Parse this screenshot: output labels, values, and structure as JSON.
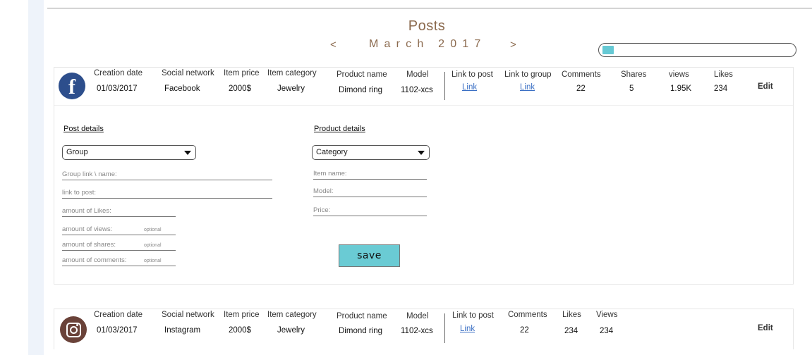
{
  "page": {
    "title": "Posts",
    "prev_symbol": "<",
    "next_symbol": ">",
    "month_label": "March 2017",
    "progress_fraction": 0.06
  },
  "posts": [
    {
      "network_icon": "facebook-icon",
      "headers": {
        "creation_date": "Creation date",
        "social_network": "Social network",
        "item_price": "Item price",
        "item_category": "Item category",
        "product_name": "Product name",
        "model": "Model",
        "link_to_post": "Link to post",
        "link_to_group": "Link to group",
        "comments": "Comments",
        "shares": "Shares",
        "views": "views",
        "likes": "Likes"
      },
      "values": {
        "creation_date": "01/03/2017",
        "social_network": "Facebook",
        "item_price": "2000$",
        "item_category": "Jewelry",
        "product_name": "Dimond ring",
        "model": "1102-xcs",
        "link_to_post": "Link",
        "link_to_group": "Link",
        "comments": "22",
        "shares": "5",
        "views": "1.95K",
        "likes": "234"
      },
      "edit_label": "Edit"
    },
    {
      "network_icon": "instagram-icon",
      "headers": {
        "creation_date": "Creation date",
        "social_network": "Social network",
        "item_price": "Item price",
        "item_category": "Item category",
        "product_name": "Product name",
        "model": "Model",
        "link_to_post": "Link to post",
        "comments": "Comments",
        "likes": "Likes",
        "views": "Views"
      },
      "values": {
        "creation_date": "01/03/2017",
        "social_network": "Instagram",
        "item_price": "2000$",
        "item_category": "Jewelry",
        "product_name": "Dimond ring",
        "model": "1102-xcs",
        "link_to_post": "Link",
        "comments": "22",
        "likes": "234",
        "views": "234"
      },
      "edit_label": "Edit"
    }
  ],
  "post_details": {
    "heading": "Post details",
    "group_select": "Group",
    "fields": {
      "group_link": "Group link \\ name:",
      "link_to_post": "link to post:",
      "likes": "amount of Likes:",
      "views": "amount of views:",
      "shares": "amount of shares:",
      "comments": "amount of comments:"
    },
    "optional_label": "optional"
  },
  "product_details": {
    "heading": "Product details",
    "category_select": "Category",
    "fields": {
      "item_name": "Item name:",
      "model": "Model:",
      "price": "Price:"
    }
  },
  "save_label": "save",
  "colors": {
    "accent_brown": "#8b6a4e",
    "save_teal": "#6acbd4",
    "link_blue": "#3a6fc4",
    "facebook_blue": "#2d4e8c",
    "instagram_brown": "#6a4239"
  }
}
